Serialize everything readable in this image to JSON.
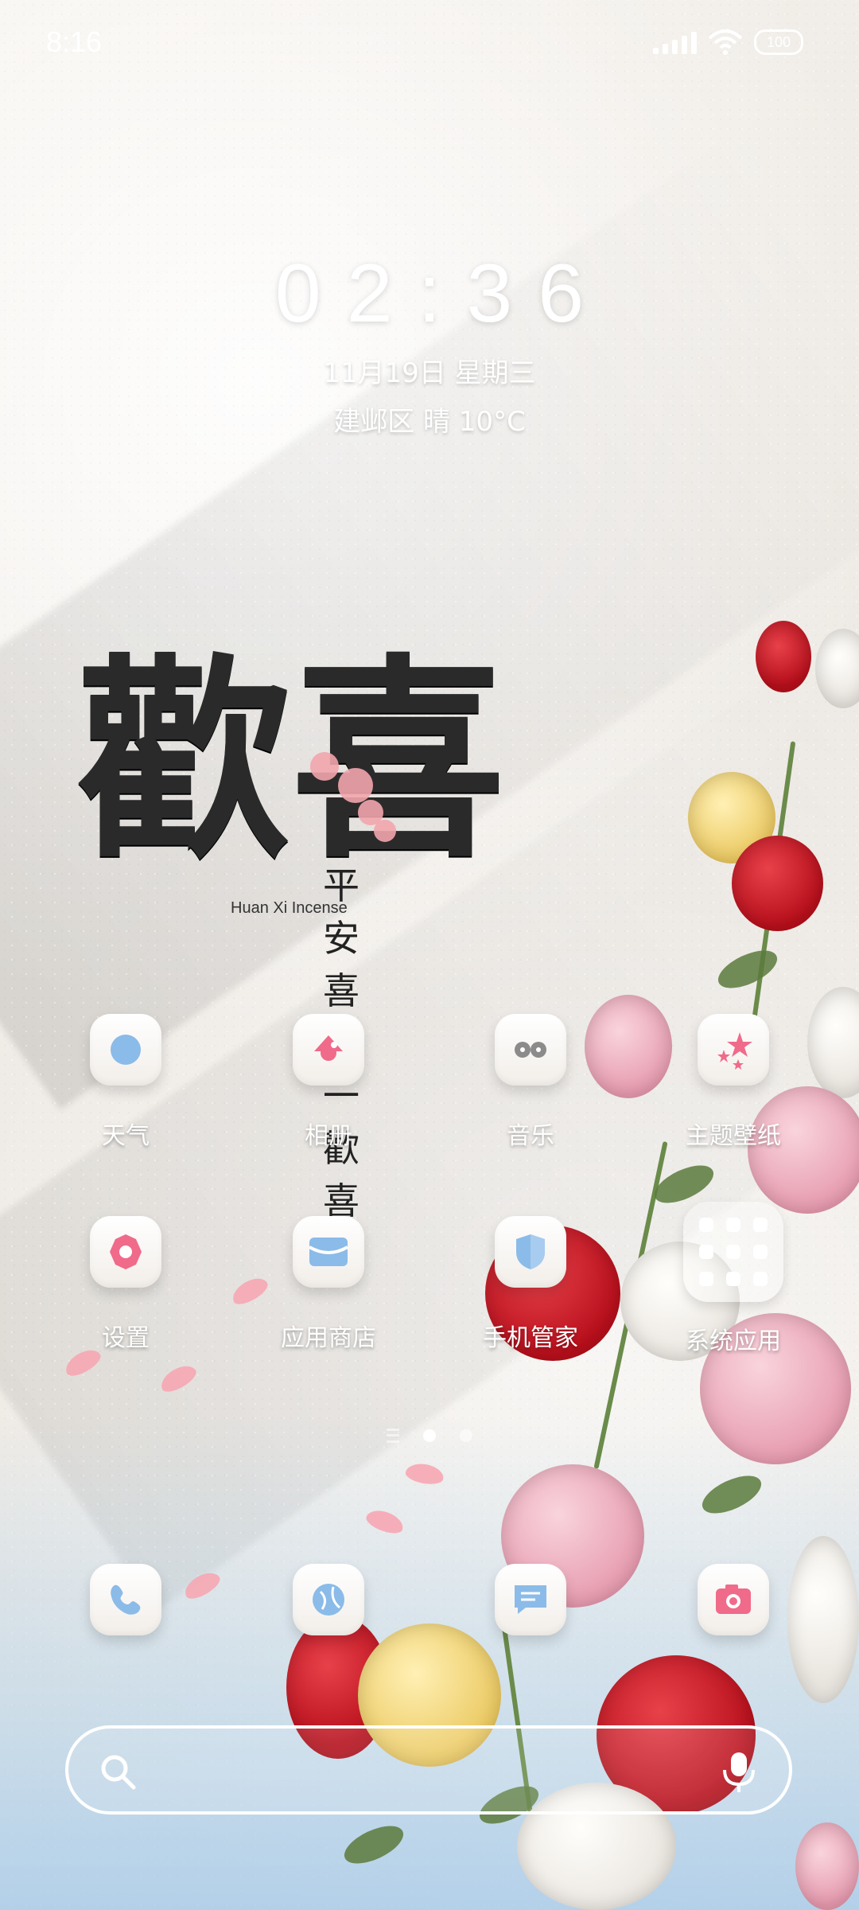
{
  "status_bar": {
    "time": "8:16",
    "battery": "100"
  },
  "clock_widget": {
    "time": "02:36",
    "date": "11月19日 星期三",
    "weather": "建邺区 晴 10°C"
  },
  "apps_row1": [
    {
      "label": "天气",
      "icon": "weather-icon"
    },
    {
      "label": "相册",
      "icon": "gallery-icon"
    },
    {
      "label": "音乐",
      "icon": "music-icon"
    },
    {
      "label": "主题壁纸",
      "icon": "themes-icon"
    }
  ],
  "apps_row2": [
    {
      "label": "设置",
      "icon": "settings-icon"
    },
    {
      "label": "应用商店",
      "icon": "app-store-icon"
    },
    {
      "label": "手机管家",
      "icon": "security-icon"
    },
    {
      "label": "系统应用",
      "icon": "folder-icon"
    }
  ],
  "dock": [
    {
      "icon": "phone-icon"
    },
    {
      "icon": "browser-icon"
    },
    {
      "icon": "messages-icon"
    },
    {
      "icon": "camera-icon"
    }
  ],
  "wallpaper": {
    "calligraphy": "歡喜",
    "logo_text": "Huan Xi Incense",
    "vertical_text": "平安喜樂一歡喜"
  },
  "colors": {
    "accent_pink": "#f06a8a",
    "accent_blue": "#8bbbe8"
  }
}
